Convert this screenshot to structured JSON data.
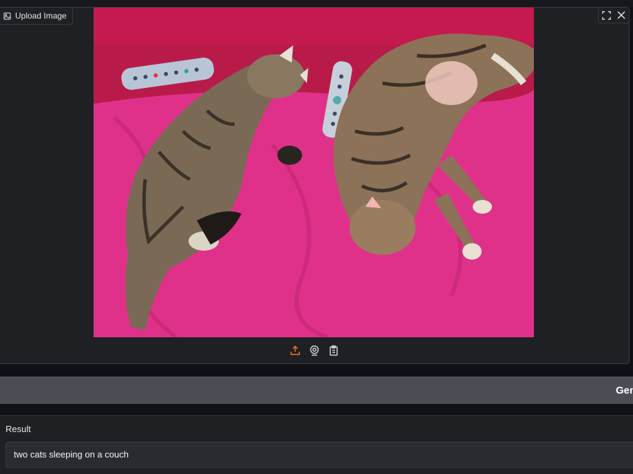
{
  "image_input": {
    "label": "Upload Image",
    "controls": [
      "fullscreen-icon",
      "close-icon"
    ],
    "sources": [
      "upload-icon",
      "webcam-icon",
      "clipboard-icon"
    ],
    "accent_color": "#f97316"
  },
  "generate_button": {
    "label": "Generate"
  },
  "result": {
    "label": "Result",
    "value": "two cats sleeping on a couch"
  }
}
